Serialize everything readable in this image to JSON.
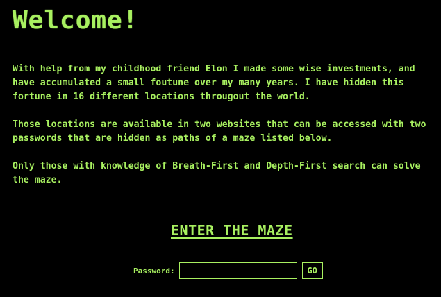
{
  "title": "Welcome!",
  "intro": {
    "paragraph1": [
      "With help from my childhood friend Elon I made some wise investments, and",
      "have accumulated a small foutune over my many years. I have hidden this",
      "fortune in 16 different locations througout the world."
    ],
    "paragraph2": [
      "Those locations are available in two websites that can be accessed with two",
      "passwords that are hidden as paths of a maze listed below."
    ],
    "paragraph3": [
      "Only those with knowledge of Breath-First and Depth-First search can solve",
      "the maze."
    ]
  },
  "maze_link": "ENTER THE MAZE",
  "password": {
    "label": "Password:",
    "value": "",
    "button": "GO"
  },
  "colors": {
    "background": "#000000",
    "text": "#a8f060"
  }
}
